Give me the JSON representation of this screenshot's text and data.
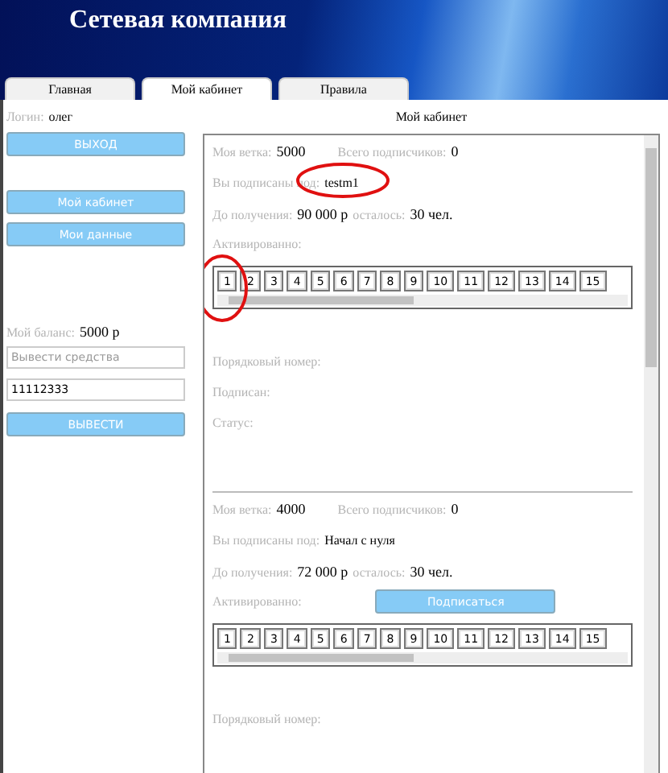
{
  "header": {
    "title": "Сетевая компания"
  },
  "tabs": [
    {
      "label": "Главная",
      "selected": false
    },
    {
      "label": "Мой кабинет",
      "selected": true
    },
    {
      "label": "Правила",
      "selected": false
    }
  ],
  "sidebar": {
    "login_label": "Логин:",
    "login_value": "олег",
    "logout_button": "ВЫХОД",
    "nav_buttons": [
      "Мой кабинет",
      "Мои данные"
    ],
    "balance_label": "Мой баланс:",
    "balance_value": "5000 р",
    "withdraw_field": {
      "placeholder": "Вывести средства"
    },
    "amount_field": {
      "value": "11112333"
    },
    "withdraw_button": "ВЫВЕСТИ"
  },
  "main": {
    "title": "Мой кабинет",
    "branches": [
      {
        "branch_label": "Моя ветка:",
        "branch_value": "5000",
        "subscribers_label": "Всего подписчиков:",
        "subscribers_value": "0",
        "subscribed_label": "Вы подписаны под:",
        "subscribed_value": "testm1",
        "subscribed_circled": true,
        "payout_label": "До получения:",
        "payout_value": "90 000 р",
        "remaining_label": "осталось:",
        "remaining_value": "30 чел.",
        "activated_label": "Активированно:",
        "slots": [
          {
            "label": "1",
            "circled": true
          },
          {
            "label": "2",
            "circled": false
          },
          {
            "label": "3",
            "circled": false
          },
          {
            "label": "4",
            "circled": false
          },
          {
            "label": "5",
            "circled": false
          },
          {
            "label": "6",
            "circled": false
          },
          {
            "label": "7",
            "circled": false
          },
          {
            "label": "8",
            "circled": false
          },
          {
            "label": "9",
            "circled": false
          },
          {
            "label": "10",
            "circled": false
          },
          {
            "label": "11",
            "circled": false
          },
          {
            "label": "12",
            "circled": false
          },
          {
            "label": "13",
            "circled": false
          },
          {
            "label": "14",
            "circled": false
          },
          {
            "label": "15",
            "circled": false
          }
        ],
        "details": [
          "Порядковый номер:",
          "Подписан:",
          "Статус:"
        ]
      },
      {
        "branch_label": "Моя ветка:",
        "branch_value": "4000",
        "subscribers_label": "Всего подписчиков:",
        "subscribers_value": "0",
        "subscribed_label": "Вы подписаны под:",
        "subscribed_value": "Начал с нуля",
        "subscribed_circled": false,
        "payout_label": "До получения:",
        "payout_value": "72 000 р",
        "remaining_label": "осталось:",
        "remaining_value": "30 чел.",
        "activated_label": "Активированно:",
        "subscribe_button": "Подписаться",
        "slots": [
          {
            "label": "1",
            "circled": false
          },
          {
            "label": "2",
            "circled": false
          },
          {
            "label": "3",
            "circled": false
          },
          {
            "label": "4",
            "circled": false
          },
          {
            "label": "5",
            "circled": false
          },
          {
            "label": "6",
            "circled": false
          },
          {
            "label": "7",
            "circled": false
          },
          {
            "label": "8",
            "circled": false
          },
          {
            "label": "9",
            "circled": false
          },
          {
            "label": "10",
            "circled": false
          },
          {
            "label": "11",
            "circled": false
          },
          {
            "label": "12",
            "circled": false
          },
          {
            "label": "13",
            "circled": false
          },
          {
            "label": "14",
            "circled": false
          },
          {
            "label": "15",
            "circled": false
          }
        ],
        "details": [
          "Порядковый номер:"
        ]
      }
    ]
  }
}
